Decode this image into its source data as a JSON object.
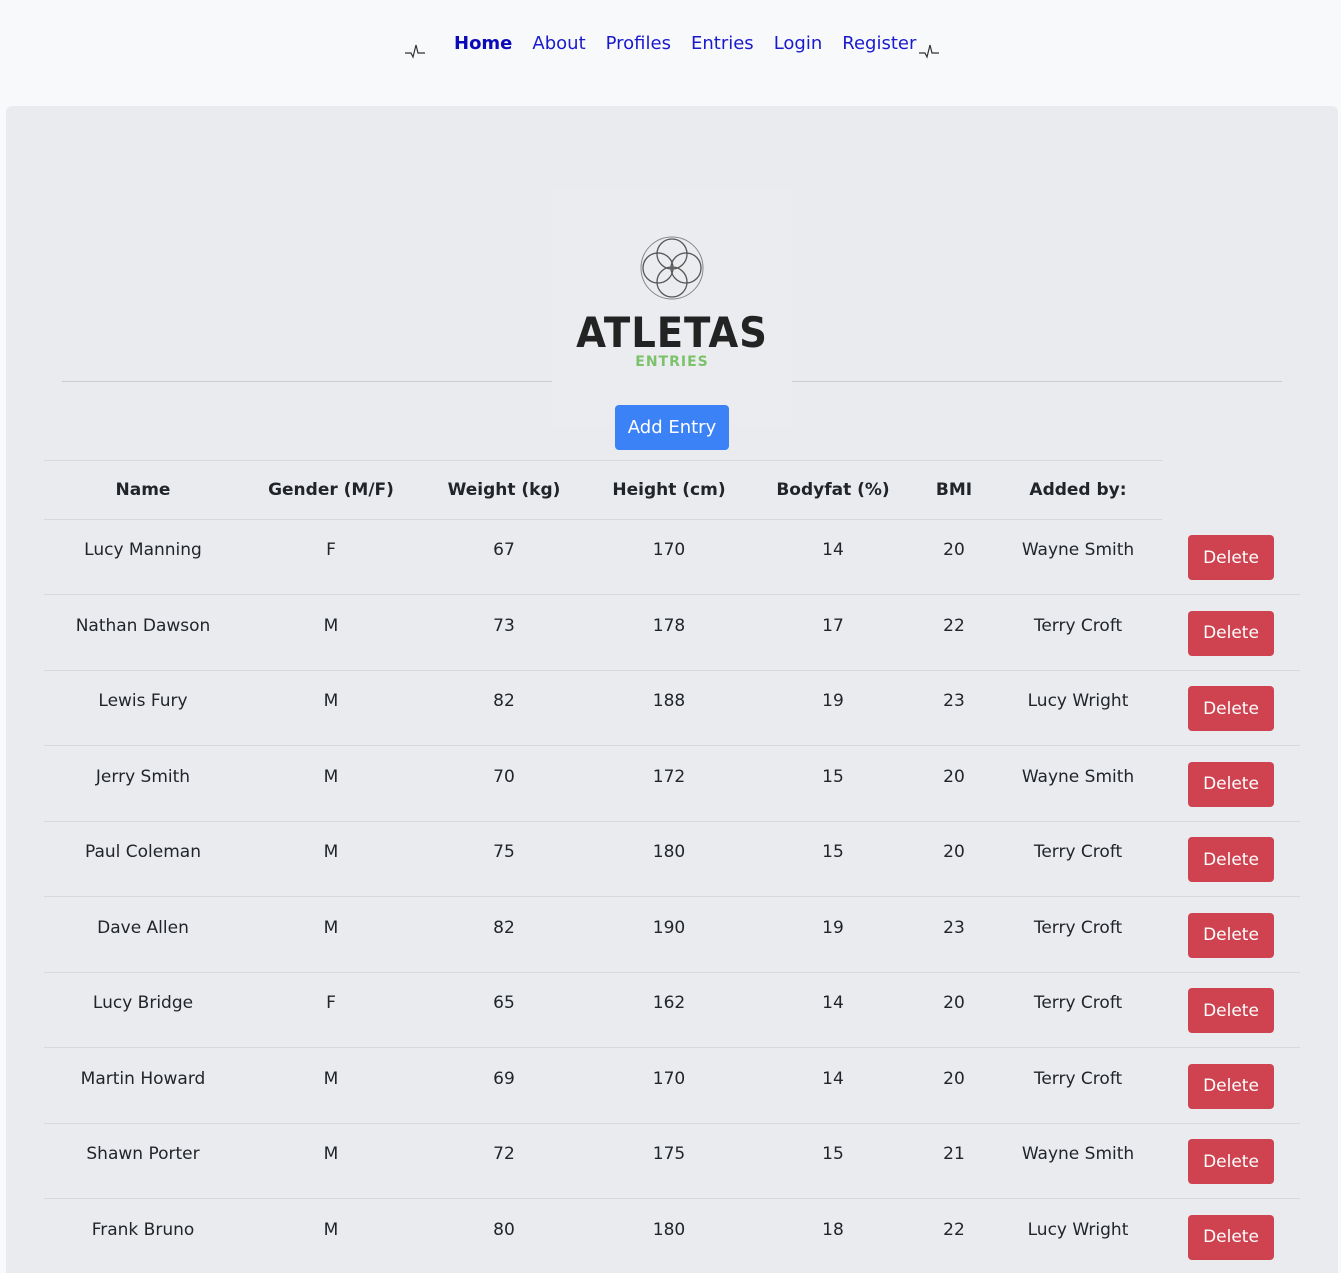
{
  "nav": {
    "left_icon": "pulse-icon",
    "right_icon": "pulse-icon",
    "links": [
      "Home",
      "About",
      "Profiles",
      "Entries",
      "Login",
      "Register"
    ],
    "active": "Home"
  },
  "logo": {
    "title": "ATLETAS",
    "subtitle": "ENTRIES",
    "subtitle_color": "#7cc26b"
  },
  "actions": {
    "add_label": "Add Entry",
    "delete_label": "Delete",
    "add_color": "#3b82f6",
    "delete_color": "#cf4350"
  },
  "table": {
    "headers": [
      "Name",
      "Gender (M/F)",
      "Weight (kg)",
      "Height (cm)",
      "Bodyfat (%)",
      "BMI",
      "Added by:"
    ],
    "rows": [
      {
        "name": "Lucy Manning",
        "gender": "F",
        "weight": "67",
        "height": "170",
        "bodyfat": "14",
        "bmi": "20",
        "added_by": "Wayne Smith"
      },
      {
        "name": "Nathan Dawson",
        "gender": "M",
        "weight": "73",
        "height": "178",
        "bodyfat": "17",
        "bmi": "22",
        "added_by": "Terry Croft"
      },
      {
        "name": "Lewis Fury",
        "gender": "M",
        "weight": "82",
        "height": "188",
        "bodyfat": "19",
        "bmi": "23",
        "added_by": "Lucy Wright"
      },
      {
        "name": "Jerry Smith",
        "gender": "M",
        "weight": "70",
        "height": "172",
        "bodyfat": "15",
        "bmi": "20",
        "added_by": "Wayne Smith"
      },
      {
        "name": "Paul Coleman",
        "gender": "M",
        "weight": "75",
        "height": "180",
        "bodyfat": "15",
        "bmi": "20",
        "added_by": "Terry Croft"
      },
      {
        "name": "Dave Allen",
        "gender": "M",
        "weight": "82",
        "height": "190",
        "bodyfat": "19",
        "bmi": "23",
        "added_by": "Terry Croft"
      },
      {
        "name": "Lucy Bridge",
        "gender": "F",
        "weight": "65",
        "height": "162",
        "bodyfat": "14",
        "bmi": "20",
        "added_by": "Terry Croft"
      },
      {
        "name": "Martin Howard",
        "gender": "M",
        "weight": "69",
        "height": "170",
        "bodyfat": "14",
        "bmi": "20",
        "added_by": "Terry Croft"
      },
      {
        "name": "Shawn Porter",
        "gender": "M",
        "weight": "72",
        "height": "175",
        "bodyfat": "15",
        "bmi": "21",
        "added_by": "Wayne Smith"
      },
      {
        "name": "Frank Bruno",
        "gender": "M",
        "weight": "80",
        "height": "180",
        "bodyfat": "18",
        "bmi": "22",
        "added_by": "Lucy Wright"
      }
    ]
  }
}
